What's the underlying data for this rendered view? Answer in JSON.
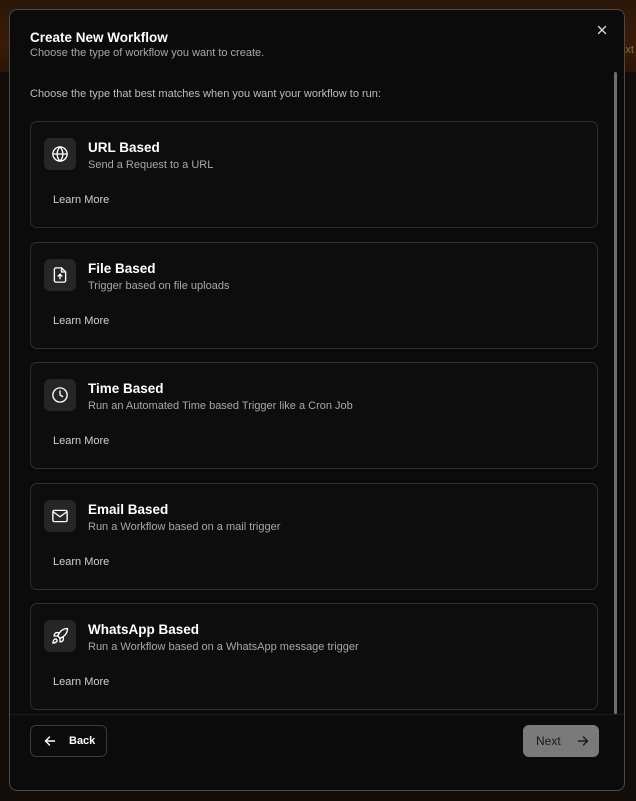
{
  "backdrop": {
    "peek_text": "ext"
  },
  "modal": {
    "title": "Create New Workflow",
    "subtitle": "Choose the type of workflow you want to create.",
    "intro": "Choose the type that best matches when you want your workflow to run:",
    "close_icon": "close-icon"
  },
  "options": [
    {
      "icon": "globe-icon",
      "title": "URL Based",
      "description": "Send a Request to a URL",
      "learn_more": "Learn More"
    },
    {
      "icon": "file-upload-icon",
      "title": "File Based",
      "description": "Trigger based on file uploads",
      "learn_more": "Learn More"
    },
    {
      "icon": "clock-icon",
      "title": "Time Based",
      "description": "Run an Automated Time based Trigger like a Cron Job",
      "learn_more": "Learn More"
    },
    {
      "icon": "mail-icon",
      "title": "Email Based",
      "description": "Run a Workflow based on a mail trigger",
      "learn_more": "Learn More"
    },
    {
      "icon": "rocket-icon",
      "title": "WhatsApp Based",
      "description": "Run a Workflow based on a WhatsApp message trigger",
      "learn_more": "Learn More"
    }
  ],
  "footer": {
    "back_label": "Back",
    "back_icon": "arrow-left-icon",
    "next_label": "Next",
    "next_icon": "arrow-right-icon",
    "next_enabled": false
  },
  "colors": {
    "modal_bg": "#0b0b0b",
    "card_border": "#2e2e2e",
    "icon_tile": "#262626",
    "next_disabled_bg": "#7a7a7a",
    "backdrop_accent": "#3a1c06"
  }
}
